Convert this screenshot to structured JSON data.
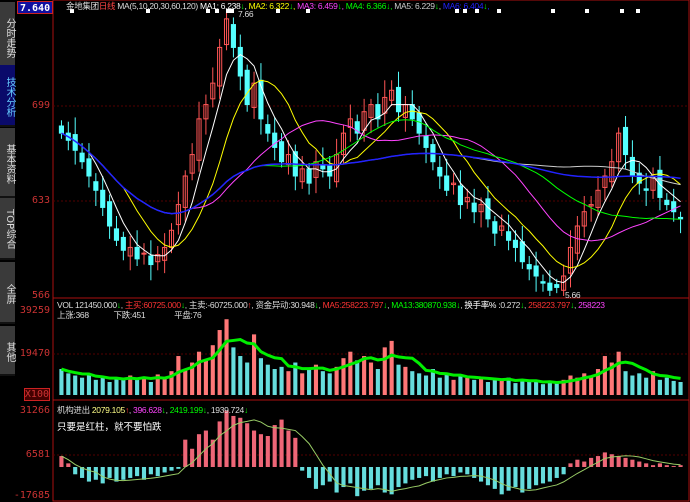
{
  "tabs": [
    "分时走势",
    "技术分析",
    "基本资料",
    "TOP综合",
    "全屏",
    "其他"
  ],
  "active_tab": "技术分析",
  "current_price": "7.640",
  "price_panel": {
    "title": "金地集团",
    "period": "日线",
    "ma_params": "MA(5,10,20,30,60,120)",
    "ma": [
      {
        "label": "MA1:",
        "value": "6.238",
        "color": "#ffffff"
      },
      {
        "label": "MA2:",
        "value": "6.322",
        "color": "#ffff00"
      },
      {
        "label": "MA3:",
        "value": "6.459",
        "color": "#ff44ff"
      },
      {
        "label": "MA4:",
        "value": "6.366",
        "color": "#00ff00"
      },
      {
        "label": "MA5:",
        "value": "6.229",
        "color": "#cccccc"
      },
      {
        "label": "MA6:",
        "value": "6.404",
        "color": "#2222ff"
      }
    ],
    "axis_labels": [
      "699",
      "633",
      "566"
    ],
    "high_label": "7.66",
    "low_label": "5.66"
  },
  "volume_panel": {
    "vol_label": "VOL",
    "vol_value": "121450.000",
    "buy_label": "主买:",
    "buy_value": "60725.000",
    "sell_label": "主卖:",
    "sell_value": "-60725.000",
    "flow_label": "资金异动:",
    "flow_value": "30.948",
    "ma5_label": "MA5:",
    "ma5_value": "258223.797",
    "ma13_label": "MA13:",
    "ma13_value": "380870.938",
    "turnover_label": "换手率% :",
    "turnover_value": "0.272",
    "extra1": "258223.797",
    "extra2": "258223",
    "up_label": "上涨:368",
    "down_label": "下跌:451",
    "flat_label": "平盘:76",
    "axis_labels": [
      "39259",
      "19470"
    ],
    "unit": "X100"
  },
  "flow_panel": {
    "title": "机构进出",
    "v1": "2079.105",
    "v2": "396.628",
    "v3": "2419.199",
    "v4": "1939.724",
    "slogan": "只要是红柱，就不要怕跌",
    "axis_labels": [
      "31266",
      "6581",
      "-17685"
    ]
  },
  "colors": {
    "up": "#ff5555",
    "down": "#55ffff",
    "border": "#aa1111",
    "ma": [
      "#ffffff",
      "#ffff00",
      "#ff44ff",
      "#00ff00",
      "#cccccc",
      "#2222ff"
    ]
  },
  "chart_data": {
    "type": "candlestick",
    "price_range": [
      566,
      766
    ],
    "closes": [
      680,
      675,
      668,
      660,
      650,
      640,
      628,
      615,
      605,
      598,
      600,
      592,
      596,
      588,
      595,
      600,
      612,
      630,
      650,
      665,
      690,
      700,
      715,
      740,
      760,
      740,
      720,
      700,
      715,
      690,
      680,
      670,
      660,
      665,
      650,
      655,
      645,
      660,
      655,
      650,
      665,
      680,
      690,
      680,
      695,
      700,
      690,
      705,
      710,
      695,
      700,
      690,
      680,
      670,
      660,
      650,
      640,
      645,
      630,
      635,
      625,
      630,
      620,
      610,
      615,
      605,
      600,
      590,
      585,
      580,
      575,
      570,
      572,
      580,
      600,
      615,
      625,
      630,
      640,
      650,
      660,
      680,
      665,
      650,
      645,
      640,
      650,
      635,
      630,
      625,
      620
    ],
    "volume": [
      120,
      100,
      90,
      80,
      95,
      70,
      85,
      60,
      80,
      75,
      90,
      70,
      85,
      60,
      95,
      80,
      110,
      180,
      120,
      150,
      200,
      160,
      230,
      300,
      350,
      220,
      180,
      150,
      280,
      170,
      140,
      120,
      130,
      110,
      150,
      100,
      120,
      140,
      110,
      100,
      130,
      170,
      200,
      160,
      180,
      150,
      120,
      220,
      250,
      140,
      130,
      110,
      100,
      90,
      120,
      80,
      100,
      70,
      90,
      80,
      70,
      85,
      60,
      75,
      65,
      80,
      55,
      70,
      60,
      65,
      50,
      60,
      55,
      70,
      90,
      80,
      100,
      85,
      120,
      180,
      150,
      200,
      110,
      90,
      100,
      80,
      110,
      70,
      80,
      65,
      60
    ],
    "flow": [
      60,
      20,
      -40,
      -60,
      -80,
      -70,
      -90,
      -60,
      -80,
      -70,
      -60,
      -50,
      -70,
      -40,
      -50,
      -30,
      -20,
      -10,
      150,
      100,
      180,
      200,
      150,
      250,
      310,
      280,
      270,
      240,
      200,
      180,
      170,
      230,
      260,
      200,
      160,
      -20,
      -60,
      -120,
      -100,
      -80,
      -140,
      -110,
      -90,
      -160,
      -130,
      -120,
      -100,
      -140,
      -150,
      -110,
      -90,
      -70,
      -60,
      -50,
      -80,
      -60,
      -40,
      -50,
      -30,
      -40,
      -60,
      -80,
      -100,
      -120,
      -150,
      -130,
      -110,
      -140,
      -120,
      -100,
      -90,
      -80,
      -60,
      -40,
      20,
      40,
      30,
      50,
      60,
      80,
      70,
      60,
      50,
      40,
      30,
      20,
      10,
      20,
      10,
      5,
      10
    ]
  }
}
